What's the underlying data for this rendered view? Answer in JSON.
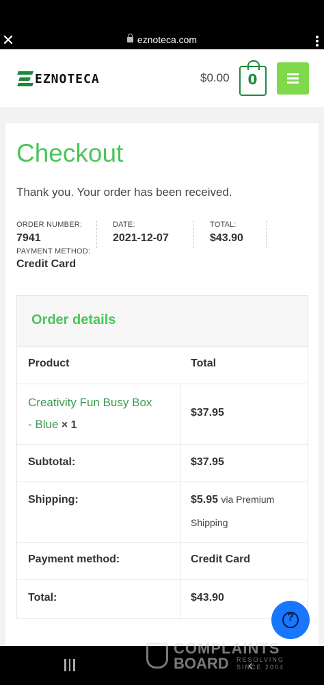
{
  "browser": {
    "url": "eznoteca.com",
    "close_glyph": "✕"
  },
  "header": {
    "logo_text": "EZNOTECA",
    "cart_total": "$0.00",
    "cart_count": "0",
    "brand_color": "#7fd94a",
    "accent_color": "#4cc45a"
  },
  "checkout": {
    "title": "Checkout",
    "thank_you": "Thank you. Your order has been received.",
    "overview": {
      "order_number_label": "ORDER NUMBER:",
      "order_number": "7941",
      "date_label": "DATE:",
      "date": "2021-12-07",
      "total_label": "TOTAL:",
      "total": "$43.90",
      "payment_method_label": "PAYMENT METHOD:",
      "payment_method": "Credit Card"
    }
  },
  "order_details": {
    "title": "Order details",
    "columns": [
      "Product",
      "Total"
    ],
    "item": {
      "name_line1": "Creativity Fun Busy Box",
      "name_line2": "- Blue",
      "quantity": "× 1",
      "total": "$37.95"
    },
    "subtotal_label": "Subtotal:",
    "subtotal": "$37.95",
    "shipping_label": "Shipping:",
    "shipping_amount": "$5.95",
    "shipping_via_line1": "via Premium",
    "shipping_via_line2": "Shipping",
    "payment_label": "Payment method:",
    "payment": "Credit Card",
    "total_label": "Total:",
    "total": "$43.90"
  },
  "help": {
    "icon": "question-icon",
    "glyph": "?"
  },
  "watermark": {
    "line1": "COMPLAINTS",
    "line2": "BOARD",
    "line3": "RESOLVING SINCE 2004"
  },
  "nav": {
    "back_glyph": "‹"
  }
}
